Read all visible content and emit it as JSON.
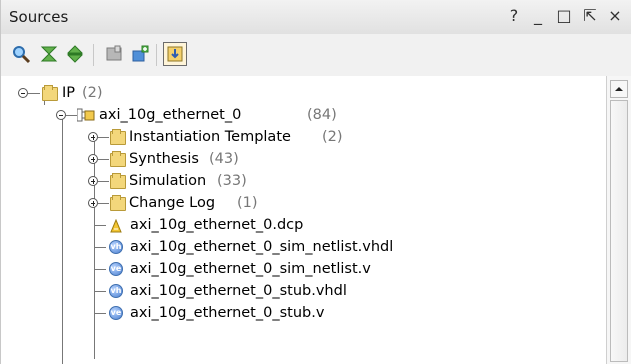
{
  "window": {
    "title": "Sources",
    "controls": [
      "?",
      "_",
      "□",
      "⇱",
      "×"
    ]
  },
  "toolbar": {
    "buttons": [
      {
        "name": "search",
        "icon": "search-icon"
      },
      {
        "name": "collapse-all",
        "icon": "collapse-all-icon"
      },
      {
        "name": "expand-all",
        "icon": "expand-all-icon"
      },
      {
        "name": "open-file",
        "icon": "open-file-icon"
      },
      {
        "name": "add-sources",
        "icon": "add-sources-icon"
      },
      {
        "name": "show-hierarchy",
        "icon": "show-hierarchy-icon",
        "active": true
      }
    ]
  },
  "tree": {
    "root": {
      "label": "IP",
      "count": "(2)"
    },
    "ip_core": {
      "label": "axi_10g_ethernet_0",
      "count": "(84)"
    },
    "folders": [
      {
        "label": "Instantiation Template",
        "count": "(2)"
      },
      {
        "label": "Synthesis",
        "count": "(43)"
      },
      {
        "label": "Simulation",
        "count": "(33)"
      },
      {
        "label": "Change Log",
        "count": "(1)"
      }
    ],
    "files": [
      {
        "label": "axi_10g_ethernet_0.dcp",
        "icon": "dcp-icon"
      },
      {
        "label": "axi_10g_ethernet_0_sim_netlist.vhdl",
        "icon": "vhdl-icon",
        "badge": "vh"
      },
      {
        "label": "axi_10g_ethernet_0_sim_netlist.v",
        "icon": "verilog-icon",
        "badge": "ve"
      },
      {
        "label": "axi_10g_ethernet_0_stub.vhdl",
        "icon": "vhdl-icon",
        "badge": "vh"
      },
      {
        "label": "axi_10g_ethernet_0_stub.v",
        "icon": "verilog-icon",
        "badge": "ve"
      }
    ]
  }
}
